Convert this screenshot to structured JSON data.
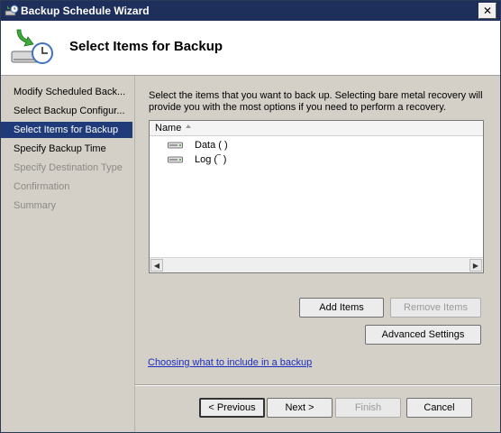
{
  "window": {
    "title": "Backup Schedule Wizard",
    "close_glyph": "✕"
  },
  "header": {
    "title": "Select Items for Backup"
  },
  "steps": [
    {
      "label": "Modify Scheduled Back...",
      "state": "done"
    },
    {
      "label": "Select Backup Configur...",
      "state": "done"
    },
    {
      "label": "Select Items for Backup",
      "state": "active"
    },
    {
      "label": "Specify Backup Time",
      "state": "done"
    },
    {
      "label": "Specify Destination Type",
      "state": "pending"
    },
    {
      "label": "Confirmation",
      "state": "pending"
    },
    {
      "label": "Summary",
      "state": "pending"
    }
  ],
  "content": {
    "description": "Select the items that you want to back up. Selecting bare metal recovery will provide you with the most options if you need to perform a recovery.",
    "list": {
      "column_name": "Name",
      "items": [
        {
          "label": "Data (  )"
        },
        {
          "label": "Log (‾ )"
        }
      ]
    },
    "add_items": "Add Items",
    "remove_items": "Remove Items",
    "advanced_settings": "Advanced Settings",
    "help_link": "Choosing what to include in a backup"
  },
  "footer": {
    "previous": "< Previous",
    "next": "Next >",
    "finish": "Finish",
    "cancel": "Cancel"
  },
  "colors": {
    "titlebar": "#1f2f5b",
    "active_step": "#1f3b7a",
    "link": "#1a2fbf"
  }
}
